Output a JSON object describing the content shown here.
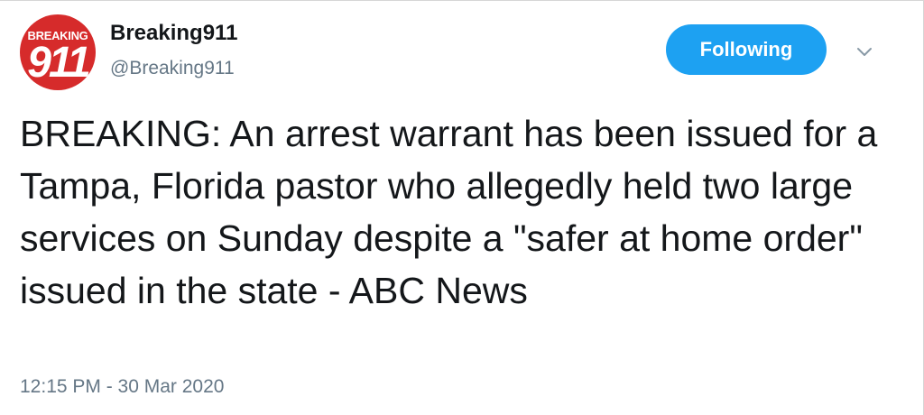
{
  "author": {
    "name": "Breaking911",
    "handle": "@Breaking911",
    "avatar_top_text": "BREAKING",
    "avatar_number": "911",
    "avatar_color": "#d62b2b"
  },
  "follow_button": {
    "label": "Following",
    "color": "#1da1f2"
  },
  "menu_icon": "chevron-down-icon",
  "tweet": {
    "text": "BREAKING: An arrest warrant has been issued for a Tampa, Florida pastor who allegedly held two large services on Sunday despite a \"safer at home order\" issued in the state - ABC News",
    "timestamp": "12:15 PM - 30 Mar 2020"
  }
}
